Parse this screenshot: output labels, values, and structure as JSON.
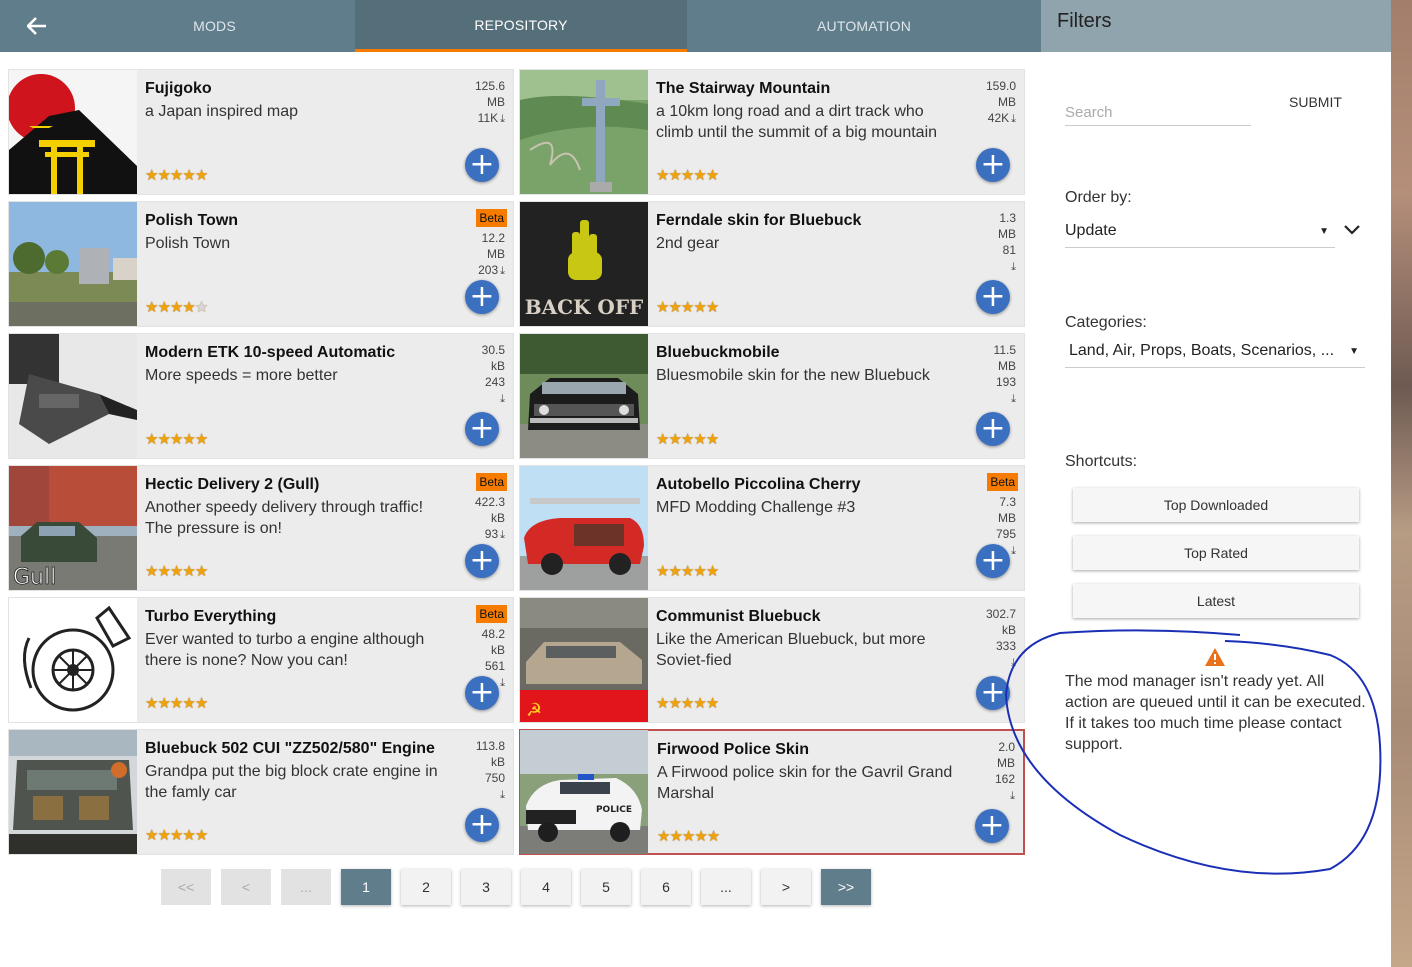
{
  "nav": {
    "tabs": [
      {
        "label": "MODS"
      },
      {
        "label": "REPOSITORY"
      },
      {
        "label": "AUTOMATION"
      }
    ]
  },
  "filters": {
    "title": "Filters",
    "search_placeholder": "Search",
    "submit_label": "SUBMIT",
    "order_label": "Order by:",
    "order_value": "Update",
    "categories_label": "Categories:",
    "categories_value": "Land, Air, Props, Boats, Scenarios, ...",
    "shortcuts_label": "Shortcuts:",
    "shortcuts": [
      "Top Downloaded",
      "Top Rated",
      "Latest"
    ],
    "warning": "The mod manager isn't ready yet. All action are queued until it can be executed. If it takes too much time please contact support."
  },
  "mods": [
    {
      "title": "Fujigoko",
      "desc": "a Japan inspired map",
      "size": "125.6",
      "unit": "MB",
      "downloads": "11K",
      "rating": 5,
      "beta": ""
    },
    {
      "title": "The Stairway Mountain",
      "desc": "a 10km long road and a dirt track who climb until the summit of a big mountain",
      "size": "159.0",
      "unit": "MB",
      "downloads": "42K",
      "rating": 5,
      "beta": ""
    },
    {
      "title": "Polish Town",
      "desc": "Polish Town",
      "size": "12.2",
      "unit": "MB",
      "downloads": "203",
      "rating": 4,
      "beta": "Beta"
    },
    {
      "title": "Ferndale skin for Bluebuck",
      "desc": "2nd gear",
      "size": "1.3",
      "unit": "MB",
      "downloads": "81",
      "rating": 5,
      "beta": ""
    },
    {
      "title": "Modern ETK 10-speed Automatic",
      "desc": "More speeds = more better",
      "size": "30.5",
      "unit": "kB",
      "downloads": "243",
      "rating": 5,
      "beta": ""
    },
    {
      "title": "Bluebuckmobile",
      "desc": "Bluesmobile skin for the new Bluebuck",
      "size": "11.5",
      "unit": "MB",
      "downloads": "193",
      "rating": 5,
      "beta": ""
    },
    {
      "title": "Hectic Delivery 2 (Gull)",
      "desc": "Another speedy delivery through traffic! The pressure is on!",
      "size": "422.3",
      "unit": "kB",
      "downloads": "93",
      "rating": 5,
      "beta": "Beta"
    },
    {
      "title": "Autobello Piccolina Cherry",
      "desc": "MFD Modding Challenge #3",
      "size": "7.3",
      "unit": "MB",
      "downloads": "795",
      "rating": 5,
      "beta": "Beta"
    },
    {
      "title": "Turbo Everything",
      "desc": "Ever wanted to turbo a engine although there is none? Now you can!",
      "size": "48.2",
      "unit": "kB",
      "downloads": "561",
      "rating": 5,
      "beta": "Beta"
    },
    {
      "title": "Communist Bluebuck",
      "desc": "Like the American Bluebuck, but more Soviet-fied",
      "size": "302.7",
      "unit": "kB",
      "downloads": "333",
      "rating": 5,
      "beta": ""
    },
    {
      "title": "Bluebuck 502 CUI \"ZZ502/580\" Engine",
      "desc": "Grandpa put the big block crate engine in the famly car",
      "size": "113.8",
      "unit": "kB",
      "downloads": "750",
      "rating": 5,
      "beta": ""
    },
    {
      "title": "Firwood Police Skin",
      "desc": "A Firwood police skin for the Gavril Grand Marshal",
      "size": "2.0",
      "unit": "MB",
      "downloads": "162",
      "rating": 5,
      "beta": ""
    }
  ],
  "thumb_texts": {
    "ferndale": "BACK OFF",
    "gull": "Gull",
    "police": "POLICE"
  },
  "pagination": [
    "<<",
    "<",
    "...",
    "1",
    "2",
    "3",
    "4",
    "5",
    "6",
    "...",
    ">",
    ">>"
  ],
  "colors": {
    "nav": "#607d8b",
    "active_tab": "#546e7a",
    "accent": "#f57c00",
    "add_button": "#3b6fc0",
    "star": "#f0a20a",
    "annotation": "#1a2fb5"
  }
}
